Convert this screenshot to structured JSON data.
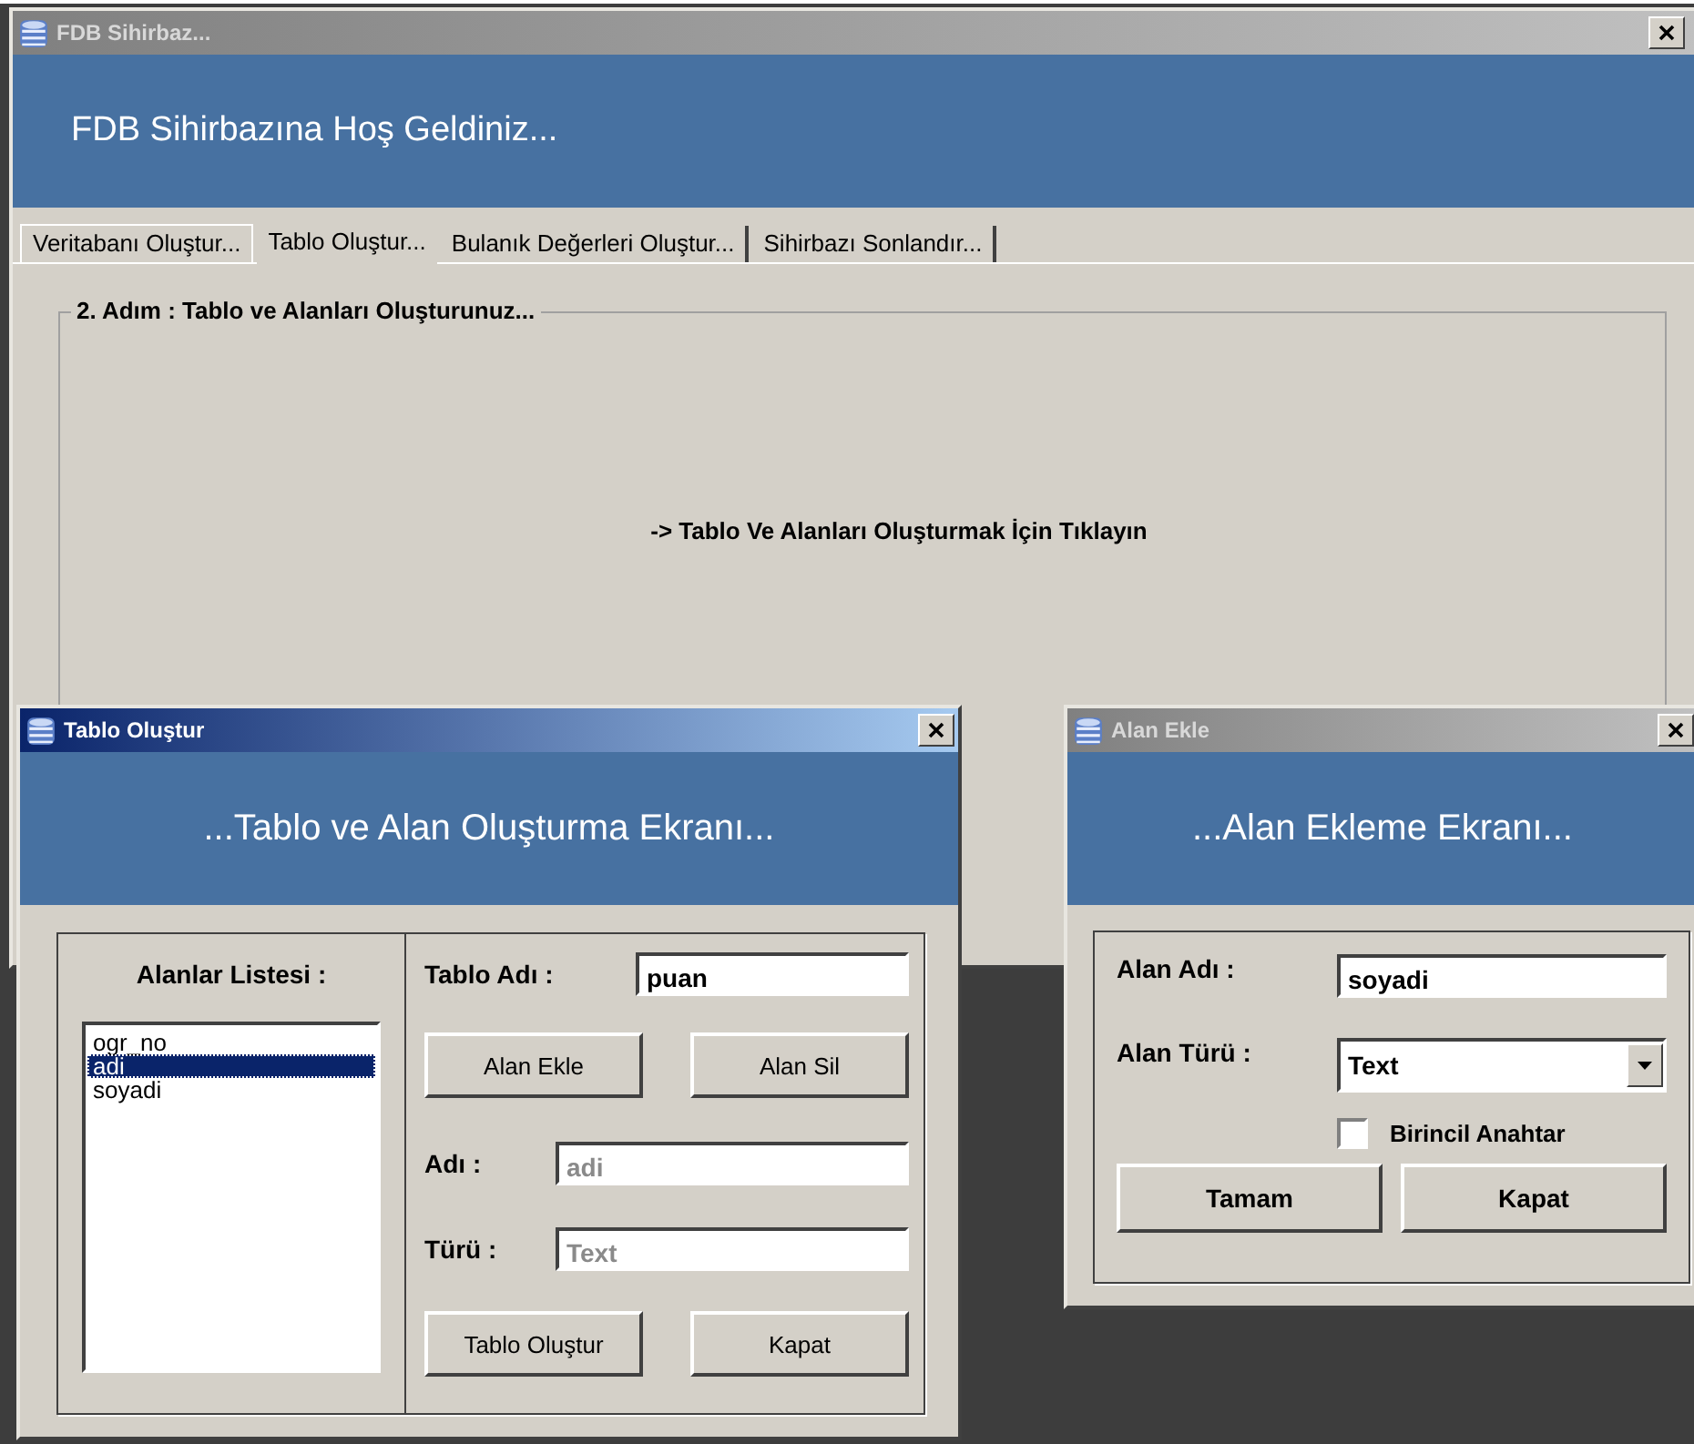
{
  "main_window": {
    "title": "FDB Sihirbaz...",
    "active": false,
    "header": "FDB Sihirbazına Hoş Geldiniz...",
    "tabs": [
      {
        "label": "Veritabanı Oluştur...",
        "selected": false
      },
      {
        "label": "Tablo Oluştur...",
        "selected": true
      },
      {
        "label": "Bulanık Değerleri Oluştur...",
        "selected": false
      },
      {
        "label": "Sihirbazı Sonlandır...",
        "selected": false
      }
    ],
    "group_title": "2. Adım : Tablo ve Alanları Oluşturunuz...",
    "prompt": "-> Tablo Ve Alanları Oluşturmak İçin Tıklayın"
  },
  "table_dialog": {
    "title": "Tablo Oluştur",
    "active": true,
    "header": "...Tablo ve Alan Oluşturma Ekranı...",
    "list_label": "Alanlar Listesi :",
    "fields": [
      {
        "text": "ogr_no",
        "selected": false
      },
      {
        "text": "adi",
        "selected": true
      },
      {
        "text": "soyadi",
        "selected": false
      }
    ],
    "table_name_label": "Tablo Adı  :",
    "table_name": "puan",
    "top_buttons": [
      "Alan Ekle",
      "Alan Sil"
    ],
    "name_label": "Adı :",
    "name_value": "adi",
    "name_disabled": true,
    "type_label": "Türü :",
    "type_value": "Text",
    "type_disabled": true,
    "bottom_buttons": [
      "Tablo Oluştur",
      "Kapat"
    ]
  },
  "field_dialog": {
    "title": "Alan Ekle",
    "active": false,
    "header": "...Alan Ekleme Ekranı...",
    "name_label": "Alan Adı :",
    "name_value": "soyadi",
    "type_label": "Alan Türü :",
    "type_value": "Text",
    "primary_key": {
      "label": "Birincil Anahtar",
      "checked": false
    },
    "buttons": [
      "Tamam",
      "Kapat"
    ]
  }
}
